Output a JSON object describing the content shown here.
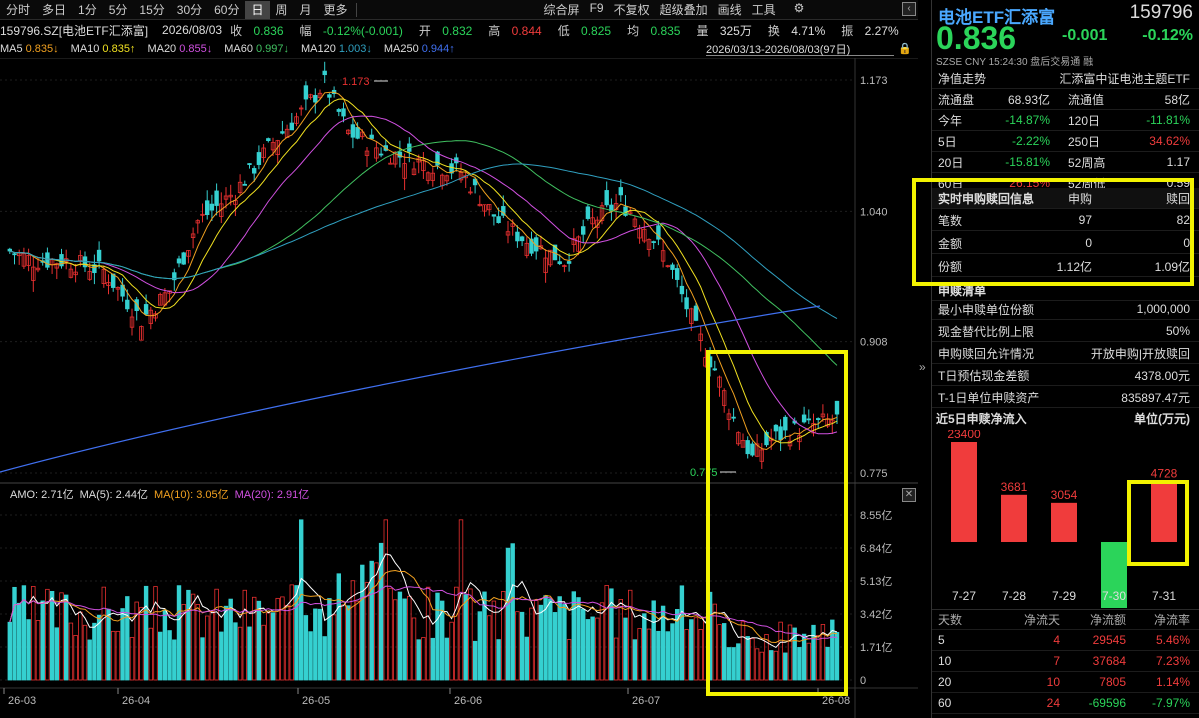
{
  "toolbar": {
    "periods": [
      "分时",
      "多日",
      "1分",
      "5分",
      "15分",
      "30分",
      "60分",
      "日",
      "周",
      "月",
      "更多"
    ],
    "active_period": "日",
    "tools": [
      "综合屏",
      "F9",
      "不复权",
      "超级叠加",
      "画线",
      "工具"
    ]
  },
  "info": {
    "symbol": "159796.SZ[电池ETF汇添富]",
    "date": "2026/08/03",
    "close_label": "收",
    "close": "0.836",
    "range_label": "幅",
    "range": "-0.12%(-0.001)",
    "open_label": "开",
    "open": "0.832",
    "high_label": "高",
    "high": "0.844",
    "low_label": "低",
    "low": "0.825",
    "avg_label": "均",
    "avg": "0.835",
    "vol_label": "量",
    "vol": "325万",
    "turn_label": "换",
    "turn": "4.71%",
    "amp_label": "振",
    "amp": "2.27%"
  },
  "ma": [
    {
      "name": "MA5",
      "value": "0.835↓",
      "color": "#f0a020"
    },
    {
      "name": "MA10",
      "value": "0.835↑",
      "color": "#f0e020"
    },
    {
      "name": "MA20",
      "value": "0.855↓",
      "color": "#d050e0"
    },
    {
      "name": "MA60",
      "value": "0.997↓",
      "color": "#40c060"
    },
    {
      "name": "MA120",
      "value": "1.003↓",
      "color": "#30a0c0"
    },
    {
      "name": "MA250",
      "value": "0.944↑",
      "color": "#4070f0"
    }
  ],
  "date_range": "2026/03/13-2026/08/03(97日)",
  "price_axis": [
    "1.173",
    "1.040",
    "0.908",
    "0.775"
  ],
  "peak_label": "1.173",
  "trough_label": "0.775",
  "volume_header": {
    "amo": "AMO: 2.71亿",
    "ma5": "MA(5): 2.44亿",
    "ma10": "MA(10): 3.05亿",
    "ma20": "MA(20): 2.91亿"
  },
  "volume_axis": [
    "8.55亿",
    "6.84亿",
    "5.13亿",
    "3.42亿",
    "1.71亿",
    "0"
  ],
  "date_axis": [
    "26-03",
    "26-04",
    "26-05",
    "26-06",
    "26-07",
    "26-08"
  ],
  "panel": {
    "title": "电池ETF汇添富",
    "code": "159796",
    "price": "0.836",
    "change": "-0.001",
    "change_pct": "-0.12%",
    "sub": "SZSE  CNY  15:24:30  盘后交易通  融",
    "nav_label": "净值走势",
    "index_name": "汇添富中证电池主题ETF",
    "stats": [
      [
        "流通盘",
        "68.93亿",
        "流通值",
        "58亿"
      ],
      [
        "今年",
        "-14.87%",
        "120日",
        "-11.81%"
      ],
      [
        "5日",
        "-2.22%",
        "250日",
        "34.62%"
      ],
      [
        "20日",
        "-15.81%",
        "52周高",
        "1.17"
      ],
      [
        "60日",
        "26.15%",
        "52周低",
        "0.59"
      ]
    ],
    "sub_head": [
      "实时申购赎回信息",
      "申购",
      "赎回"
    ],
    "sub_rows": [
      [
        "笔数",
        "97",
        "82"
      ],
      [
        "金额",
        "0",
        "0"
      ],
      [
        "份额",
        "1.12亿",
        "1.09亿"
      ]
    ],
    "list_title": "申赎清单",
    "list_rows": [
      [
        "最小申赎单位份额",
        "1,000,000"
      ],
      [
        "现金替代比例上限",
        "50%"
      ],
      [
        "申购赎回允许情况",
        "开放申购|开放赎回"
      ],
      [
        "T日预估现金差额",
        "4378.00元"
      ],
      [
        "T-1日单位申赎资产",
        "835897.47元"
      ]
    ],
    "flow_title": "近5日申赎净流入",
    "flow_unit": "单位(万元)",
    "flow_table_head": [
      "天数",
      "净流天",
      "净流额",
      "净流率"
    ],
    "flow_table": [
      [
        "5",
        "4",
        "29545",
        "5.46%"
      ],
      [
        "10",
        "7",
        "37684",
        "7.23%"
      ],
      [
        "20",
        "10",
        "7805",
        "1.14%"
      ],
      [
        "60",
        "24",
        "-69596",
        "-7.97%"
      ]
    ]
  },
  "chart_data": {
    "type": "bar",
    "title": "近5日申赎净流入",
    "unit": "单位(万元)",
    "categories": [
      "7-27",
      "7-28",
      "7-29",
      "7-30",
      "7-31"
    ],
    "values": [
      23400,
      3681,
      3054,
      -5318,
      4728
    ]
  }
}
